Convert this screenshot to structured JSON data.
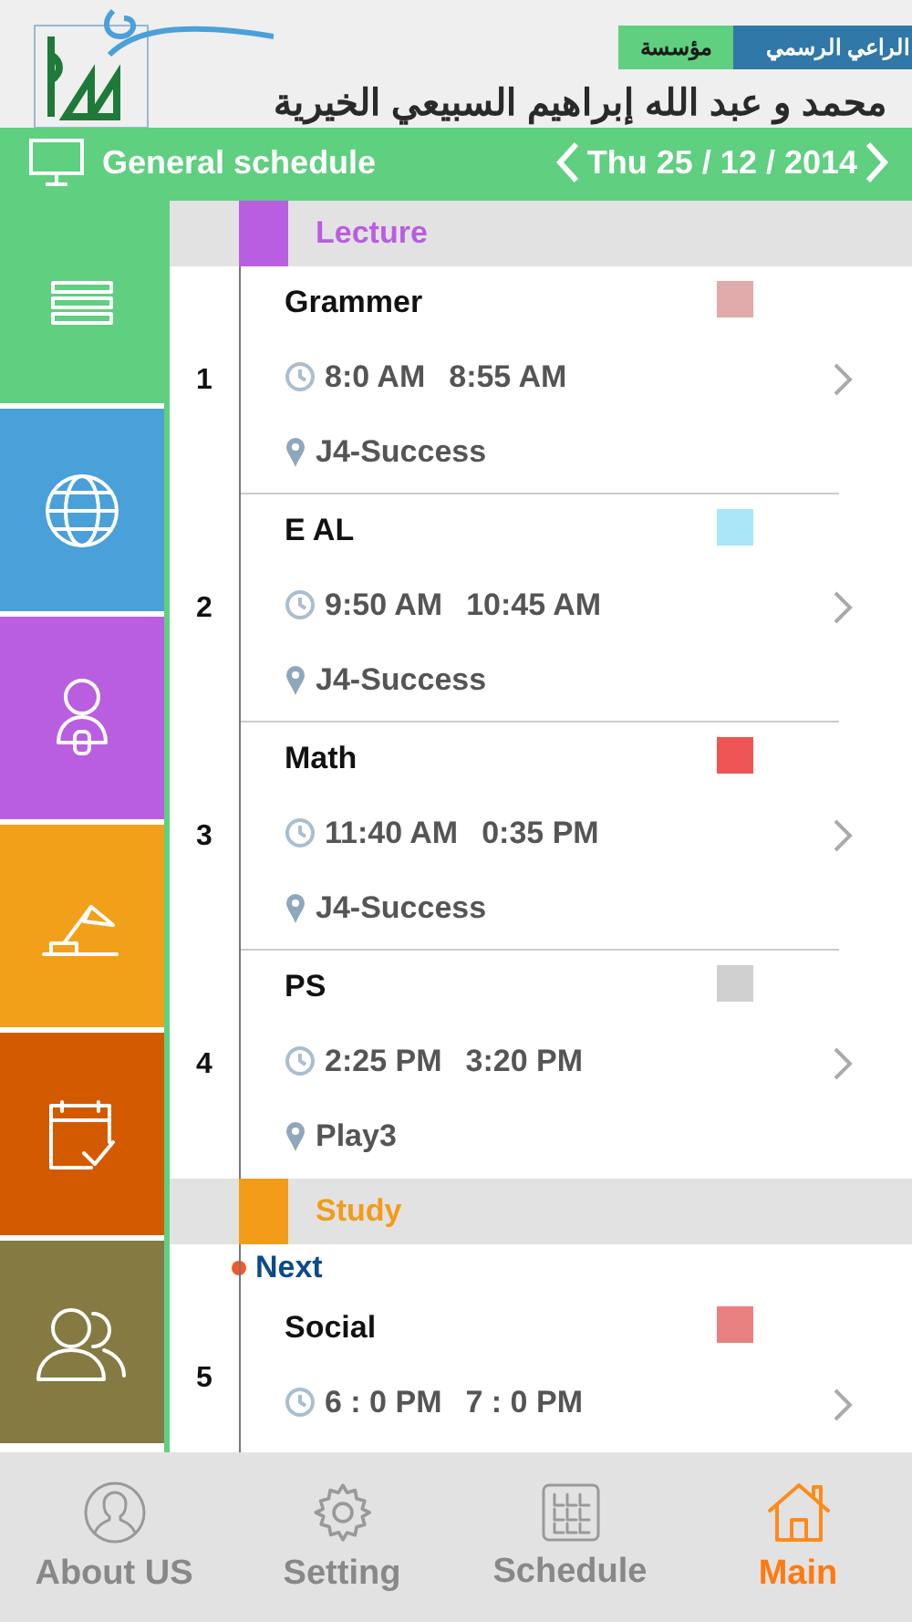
{
  "header": {
    "sponsor_labels": [
      {
        "text": "الراعي الرسمي",
        "color": "#2f78a8"
      },
      {
        "text": "مؤسسة",
        "color": "#5fcf80"
      }
    ],
    "organization": "محمد و عبد الله إبراهيم السبيعي الخيرية"
  },
  "title_bar": {
    "title": "General schedule",
    "date": "Thu 25 / 12 / 2014"
  },
  "sidebar": {
    "items": [
      {
        "kind": "list",
        "color": "#5fcf80"
      },
      {
        "kind": "globe",
        "color": "#4aa0d8"
      },
      {
        "kind": "person",
        "color": "#b95ee0"
      },
      {
        "kind": "lamp",
        "color": "#f2a01a"
      },
      {
        "kind": "calendar",
        "color": "#d45a00"
      },
      {
        "kind": "contact",
        "color": "#857a42"
      }
    ]
  },
  "schedule": {
    "sections": [
      {
        "title": "Lecture",
        "color": "#b95ee0",
        "items": [
          {
            "number": "1",
            "subject": "Grammer",
            "color": "#e0aaaa",
            "start": "8:0 AM",
            "end": "8:55 AM",
            "location": "J4-Success"
          },
          {
            "number": "2",
            "subject": "E AL",
            "color": "#a8e6f8",
            "start": "9:50 AM",
            "end": "10:45 AM",
            "location": "J4-Success"
          },
          {
            "number": "3",
            "subject": "Math",
            "color": "#ee5555",
            "start": "11:40 AM",
            "end": "0:35 PM",
            "location": "J4-Success"
          },
          {
            "number": "4",
            "subject": "PS",
            "color": "#d0d0d0",
            "start": "2:25 PM",
            "end": "3:20 PM",
            "location": "Play3"
          }
        ]
      },
      {
        "title": "Study",
        "color": "#f29c1a",
        "marker": "Next",
        "items": [
          {
            "number": "5",
            "subject": "Social",
            "color": "#e88080",
            "start": "6 : 0 PM",
            "end": "7 : 0 PM"
          }
        ]
      }
    ]
  },
  "bottom_nav": {
    "tabs": [
      {
        "kind": "person",
        "label": "About US",
        "selected": false
      },
      {
        "kind": "gear",
        "label": "Setting",
        "selected": false
      },
      {
        "kind": "grid",
        "label": "Schedule",
        "selected": false
      },
      {
        "kind": "home",
        "label": "Main",
        "selected": true
      }
    ]
  }
}
